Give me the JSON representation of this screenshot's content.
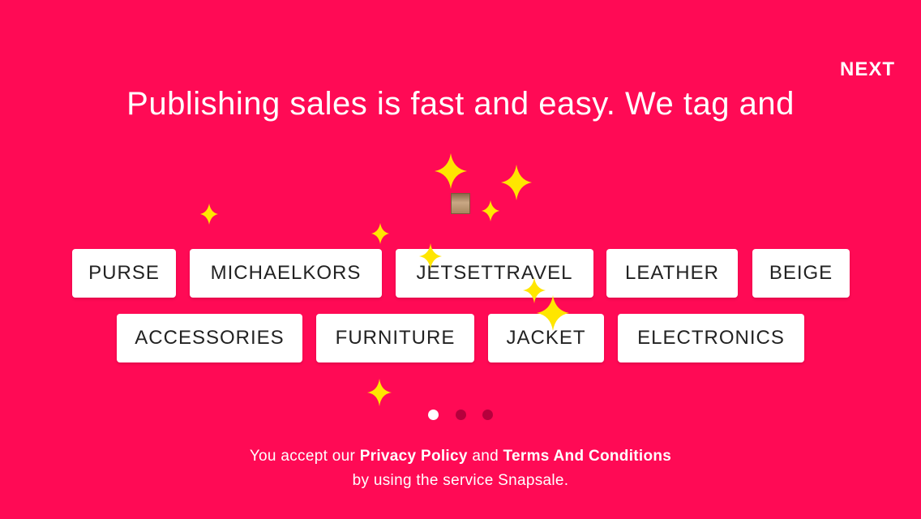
{
  "header": {
    "next_label": "NEXT"
  },
  "headline": "Publishing sales is fast and easy. We tag and",
  "tags": [
    "PURSE",
    "MICHAELKORS",
    "JETSETTRAVEL",
    "LEATHER",
    "BEIGE",
    "ACCESSORIES",
    "FURNITURE",
    "JACKET",
    "ELECTRONICS"
  ],
  "pagination": {
    "current": 1,
    "total": 3
  },
  "legal": {
    "prefix": "You accept our",
    "privacy_label": "Privacy Policy",
    "and": "and",
    "terms_label": "Terms And Conditions",
    "suffix": "by using the service Snapsale."
  },
  "colors": {
    "background": "#ff0a55",
    "sparkle": "#ffe600",
    "tag_bg": "#ffffff",
    "tag_text": "#222222"
  }
}
